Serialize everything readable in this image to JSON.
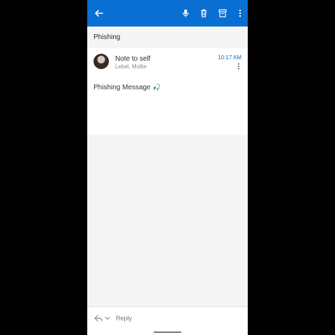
{
  "colors": {
    "accent": "#0a6fd3"
  },
  "appbar": {
    "icons": [
      "arrow-left-icon",
      "microphone-icon",
      "trash-icon",
      "archive-icon",
      "more-vertical-icon"
    ]
  },
  "subject": {
    "title": "Phishing"
  },
  "message": {
    "sender_name": "Note to self",
    "recipients": "Lebel, Mollie",
    "time": "10:17 AM",
    "body_text": "Phishing Message",
    "emoji": "🎣"
  },
  "reply": {
    "label": "Reply"
  }
}
